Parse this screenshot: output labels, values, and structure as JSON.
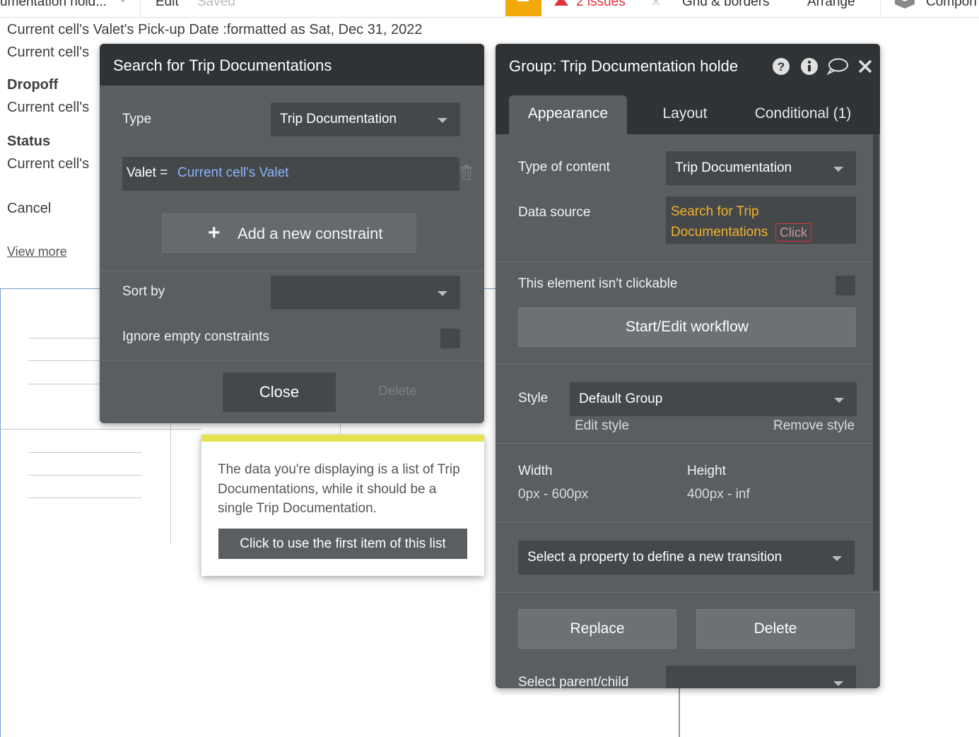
{
  "topbar": {
    "page_name": "umentation hold...",
    "edit_label": "Edit",
    "saved_label": "Saved",
    "issues_label": "2 issues",
    "grid_label": "Grid & borders",
    "arrange_label": "Arrange",
    "components_label": "Compon"
  },
  "canvas": {
    "pickup_line": "Current cell's Valet's Pick-up Date :formatted as Sat, Dec 31, 2022",
    "cell_prefix_1": "Current cell's",
    "dropoff_heading": "Dropoff",
    "cell_prefix_2": "Current cell's",
    "status_heading": "Status",
    "cell_prefix_3": "Current cell's",
    "cancel_text": "Cancel",
    "view_more_link": "View more"
  },
  "search_popup": {
    "title": "Search for Trip Documentations",
    "type_label": "Type",
    "type_value": "Trip Documentation",
    "constraint_key": "Valet =",
    "constraint_value": "Current cell's Valet",
    "add_constraint_label": "Add a new constraint",
    "sort_by_label": "Sort by",
    "sort_by_value": "",
    "ignore_empty_label": "Ignore empty constraints",
    "close_label": "Close",
    "delete_label": "Delete"
  },
  "property_editor": {
    "title": "Group: Trip Documentation holde",
    "tabs": [
      {
        "label": "Appearance"
      },
      {
        "label": "Layout"
      },
      {
        "label": "Conditional (1)"
      }
    ],
    "type_of_content_label": "Type of content",
    "type_of_content_value": "Trip Documentation",
    "data_source_label": "Data source",
    "data_source_line1": "Search for Trip",
    "data_source_line2": "Documentations",
    "data_source_click": "Click",
    "not_clickable_label": "This element isn't clickable",
    "workflow_button": "Start/Edit workflow",
    "style_label": "Style",
    "style_value": "Default Group",
    "edit_style_link": "Edit style",
    "remove_style_link": "Remove style",
    "width_label": "Width",
    "width_value": "0px - 600px",
    "height_label": "Height",
    "height_value": "400px - inf",
    "transition_placeholder": "Select a property to define a new transition",
    "replace_button": "Replace",
    "delete_button": "Delete",
    "parent_child_label": "Select parent/child",
    "parent_child_value": ""
  },
  "warning_tooltip": {
    "message": "The data you're displaying is a list of Trip Documentations, while it should be a single Trip Documentation.",
    "button_label": "Click to use the first item of this list"
  },
  "colors": {
    "panel_bg": "#5b5e61",
    "panel_header": "#2f3336",
    "field_bg": "#45484b",
    "dynamic_value": "#8ab4f8",
    "data_source_text": "#f0b429",
    "issues_red": "#e0333a",
    "tooltip_accent": "#e5e250"
  },
  "icons": [
    "dropdown-caret-icon",
    "trash-icon",
    "plus-icon",
    "help-icon",
    "info-icon",
    "comment-icon",
    "close-icon",
    "warning-icon"
  ]
}
